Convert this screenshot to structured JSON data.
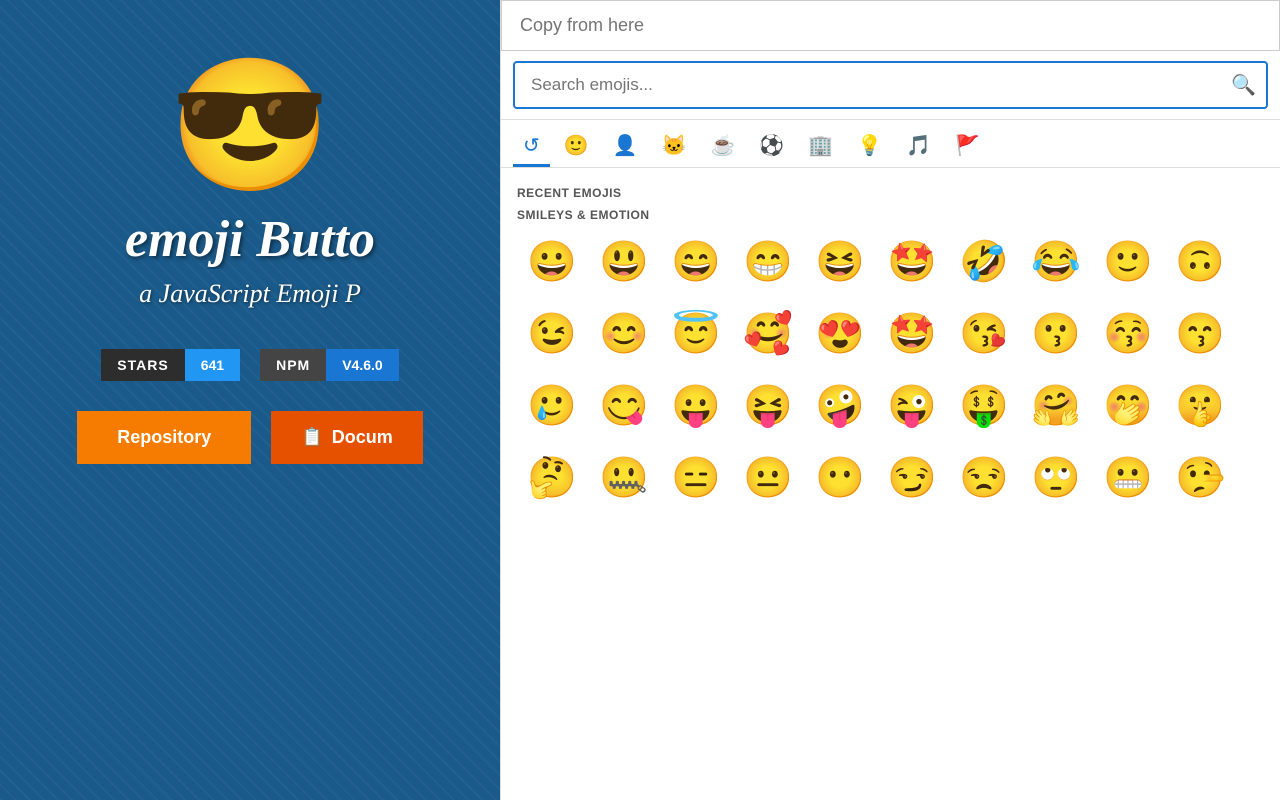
{
  "left": {
    "emoji": "😎",
    "title": "emoji Butto",
    "subtitle": "a JavaScript Emoji P",
    "stats": [
      {
        "label": "STARS",
        "value": "641",
        "value_style": "blue"
      },
      {
        "label": "NPM",
        "value": "V4.6.0",
        "value_style": "blue2"
      }
    ],
    "buttons": [
      {
        "label": "Repository",
        "style": "orange"
      },
      {
        "label": "📋 Docum",
        "style": "dark-orange"
      }
    ]
  },
  "right": {
    "copy_placeholder": "Copy from here",
    "search_placeholder": "Search emojis...",
    "categories": [
      {
        "icon": "🕐",
        "label": "Recent",
        "active": true
      },
      {
        "icon": "🙂",
        "label": "Smileys"
      },
      {
        "icon": "👤",
        "label": "People"
      },
      {
        "icon": "🐱",
        "label": "Animals"
      },
      {
        "icon": "☕",
        "label": "Food"
      },
      {
        "icon": "⚽",
        "label": "Sports"
      },
      {
        "icon": "🏢",
        "label": "Travel"
      },
      {
        "icon": "💡",
        "label": "Objects"
      },
      {
        "icon": "🎵",
        "label": "Symbols"
      },
      {
        "icon": "🚩",
        "label": "Flags"
      }
    ],
    "sections": [
      {
        "label": "RECENT EMOJIS",
        "emojis": []
      },
      {
        "label": "SMILEYS & EMOTION",
        "emojis": [
          "😀",
          "😃",
          "😄",
          "😁",
          "😆",
          "🤩",
          "🤣",
          "😂",
          "🙂",
          "🙃",
          "😉",
          "😊",
          "😇",
          "🥰",
          "😍",
          "🤩",
          "😘",
          "😗",
          "😚",
          "😙",
          "🥲",
          "😋",
          "😛",
          "😝",
          "🤪",
          "😜",
          "🤑",
          "🤗",
          "🤭",
          "🤫",
          "🤔",
          "🤐",
          "😑",
          "😐",
          "😶",
          "😏",
          "😒",
          "🙄",
          "😬",
          "🤥"
        ]
      }
    ],
    "scrollbar": true
  }
}
